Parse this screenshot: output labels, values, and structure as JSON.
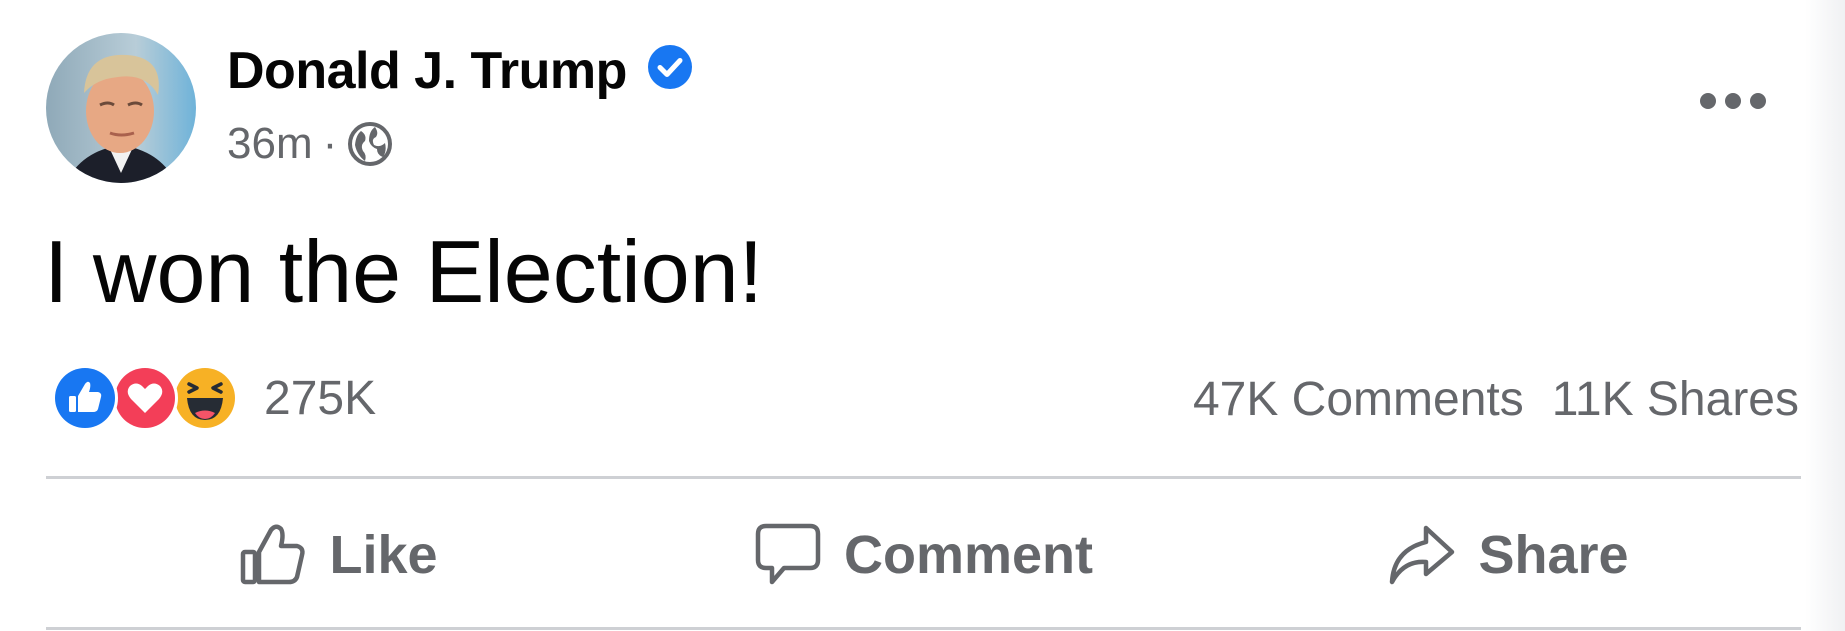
{
  "post": {
    "author_name": "Donald J. Trump",
    "verified_icon": "verified-badge-icon",
    "timestamp": "36m",
    "separator": "·",
    "audience_icon": "globe-icon",
    "more_icon": "more-options-icon",
    "message": "I won the Election!"
  },
  "reactions": {
    "icons": [
      "like-reaction-icon",
      "love-reaction-icon",
      "haha-reaction-icon"
    ],
    "count": "275K"
  },
  "stats": {
    "comments": "47K Comments",
    "shares": "11K Shares"
  },
  "actions": {
    "like_label": "Like",
    "comment_label": "Comment",
    "share_label": "Share"
  },
  "colors": {
    "text_primary": "#050505",
    "text_secondary": "#65676b",
    "verified_blue": "#1877f2",
    "like_blue": "#1877f2",
    "love_red": "#f33e58",
    "haha_yellow": "#f7b125",
    "divider": "#ced0d4"
  }
}
